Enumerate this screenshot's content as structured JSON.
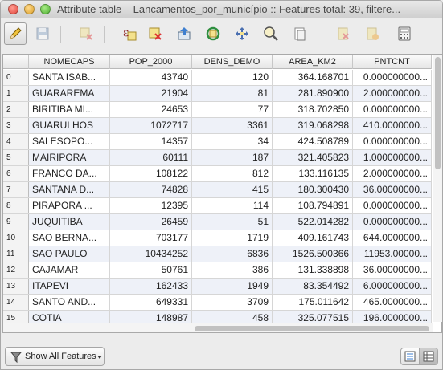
{
  "window": {
    "title": "Attribute table – Lancamentos_por_município :: Features total: 39, filtere..."
  },
  "toolbar": {
    "buttons": [
      {
        "name": "toggle-editing-icon",
        "tooltip": "Toggle editing mode",
        "state": "active"
      },
      {
        "name": "save-edits-icon",
        "tooltip": "Save edits",
        "state": "disabled"
      },
      {
        "name": "delete-selected-icon",
        "tooltip": "Delete selected features",
        "state": "disabled"
      },
      {
        "name": "select-by-expression-icon",
        "tooltip": "Select features using an expression",
        "state": "enabled"
      },
      {
        "name": "unselect-all-icon",
        "tooltip": "Unselect all",
        "state": "enabled"
      },
      {
        "name": "move-selection-to-top-icon",
        "tooltip": "Move selection to top",
        "state": "enabled"
      },
      {
        "name": "invert-selection-icon",
        "tooltip": "Invert selection",
        "state": "enabled"
      },
      {
        "name": "pan-to-selected-icon",
        "tooltip": "Pan map to selected rows",
        "state": "enabled"
      },
      {
        "name": "zoom-to-selected-icon",
        "tooltip": "Zoom map to selected rows",
        "state": "enabled"
      },
      {
        "name": "copy-selected-icon",
        "tooltip": "Copy selected rows to clipboard",
        "state": "enabled"
      },
      {
        "name": "delete-column-icon",
        "tooltip": "Delete column",
        "state": "disabled"
      },
      {
        "name": "new-column-icon",
        "tooltip": "New column",
        "state": "disabled"
      },
      {
        "name": "field-calculator-icon",
        "tooltip": "Open field calculator",
        "state": "enabled"
      }
    ]
  },
  "table": {
    "columns": [
      "NOMECAPS",
      "POP_2000",
      "DENS_DEMO",
      "AREA_KM2",
      "PNTCNT"
    ],
    "rows": [
      {
        "index": "0",
        "cells": [
          "SANTA ISAB...",
          "43740",
          "120",
          "364.168701",
          "0.000000000..."
        ]
      },
      {
        "index": "1",
        "cells": [
          "GUARAREMA",
          "21904",
          "81",
          "281.890900",
          "2.000000000..."
        ]
      },
      {
        "index": "2",
        "cells": [
          "BIRITIBA MI...",
          "24653",
          "77",
          "318.702850",
          "0.000000000..."
        ]
      },
      {
        "index": "3",
        "cells": [
          "GUARULHOS",
          "1072717",
          "3361",
          "319.068298",
          "410.0000000..."
        ]
      },
      {
        "index": "4",
        "cells": [
          "SALESOPO...",
          "14357",
          "34",
          "424.508789",
          "0.000000000..."
        ]
      },
      {
        "index": "5",
        "cells": [
          "MAIRIPORA",
          "60111",
          "187",
          "321.405823",
          "1.000000000..."
        ]
      },
      {
        "index": "6",
        "cells": [
          "FRANCO DA...",
          "108122",
          "812",
          "133.116135",
          "2.000000000..."
        ]
      },
      {
        "index": "7",
        "cells": [
          "SANTANA D...",
          "74828",
          "415",
          "180.300430",
          "36.00000000..."
        ]
      },
      {
        "index": "8",
        "cells": [
          "PIRAPORA ...",
          "12395",
          "114",
          "108.794891",
          "0.000000000..."
        ]
      },
      {
        "index": "9",
        "cells": [
          "JUQUITIBA",
          "26459",
          "51",
          "522.014282",
          "0.000000000..."
        ]
      },
      {
        "index": "10",
        "cells": [
          "SAO BERNA...",
          "703177",
          "1719",
          "409.161743",
          "644.0000000..."
        ]
      },
      {
        "index": "11",
        "cells": [
          "SAO PAULO",
          "10434252",
          "6836",
          "1526.500366",
          "11953.00000..."
        ]
      },
      {
        "index": "12",
        "cells": [
          "CAJAMAR",
          "50761",
          "386",
          "131.338898",
          "36.00000000..."
        ]
      },
      {
        "index": "13",
        "cells": [
          "ITAPEVI",
          "162433",
          "1949",
          "83.354492",
          "6.000000000..."
        ]
      },
      {
        "index": "14",
        "cells": [
          "SANTO AND...",
          "649331",
          "3709",
          "175.011642",
          "465.0000000..."
        ]
      },
      {
        "index": "15",
        "cells": [
          "COTIA",
          "148987",
          "458",
          "325.077515",
          "196.0000000..."
        ]
      }
    ]
  },
  "footer": {
    "filter_label": "Show All Features",
    "view_buttons": [
      {
        "name": "form-view-icon",
        "state": "inactive"
      },
      {
        "name": "table-view-icon",
        "state": "active"
      }
    ]
  }
}
